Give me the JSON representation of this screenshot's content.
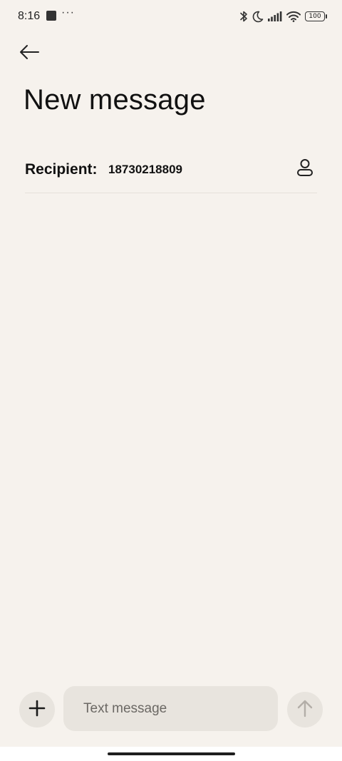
{
  "status_bar": {
    "time": "8:16",
    "more_indicator": "···",
    "battery": "100",
    "icons": [
      "square-notification-icon",
      "bluetooth-icon",
      "moon-icon",
      "signal-icon",
      "wifi-icon",
      "battery-icon"
    ]
  },
  "header": {
    "back_icon": "back-arrow-icon",
    "title": "New message"
  },
  "recipient": {
    "label": "Recipient:",
    "value": "18730218809",
    "contact_icon": "person-icon"
  },
  "compose": {
    "add_icon": "plus-icon",
    "placeholder": "Text message",
    "value": "",
    "send_icon": "arrow-up-icon"
  },
  "colors": {
    "background": "#f6f2ed",
    "input_background": "#e8e4de",
    "text": "#111111",
    "muted_icon": "#b3aea8"
  }
}
